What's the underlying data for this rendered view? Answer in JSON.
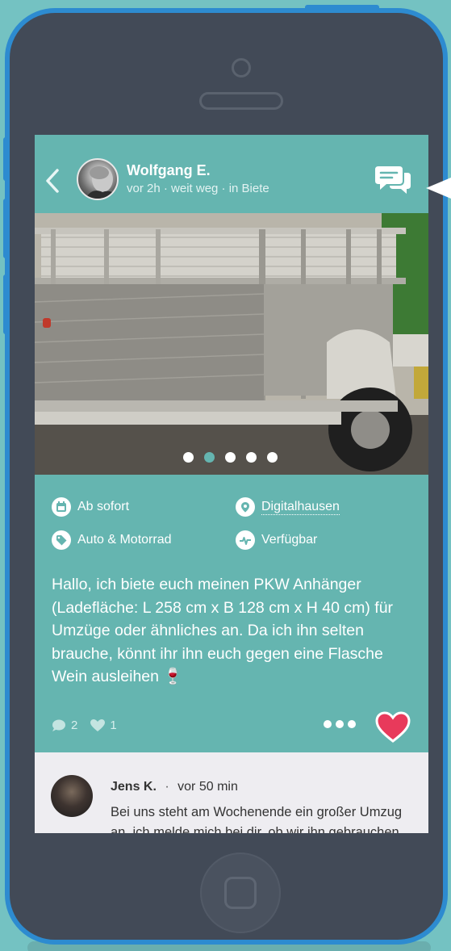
{
  "header": {
    "author": "Wolfgang E.",
    "meta": "vor 2h · weit weg · in Biete"
  },
  "carousel": {
    "count": 5,
    "active_index": 1
  },
  "tags": {
    "date": "Ab sofort",
    "location": "Digitalhausen",
    "category": "Auto & Motorrad",
    "status": "Verfügbar"
  },
  "post": {
    "text": "Hallo, ich biete euch meinen PKW Anhänger (Ladefläche: L 258 cm x B 128 cm x H 40 cm) für Umzüge oder ähnliches an. Da ich ihn selten brauche, könnt ihr ihn euch gegen eine Flasche Wein ausleihen 🍷"
  },
  "stats": {
    "comments": "2",
    "likes": "1"
  },
  "comment": {
    "author": "Jens K.",
    "separator": "·",
    "time": "vor 50 min",
    "text": "Bei uns steht am Wochenende ein großer Umzug an, ich melde mich bei dir, ob wir ihn gebrauchen können."
  },
  "colors": {
    "teal": "#65b5b0",
    "phone_blue": "#2d8bd0",
    "heart": "#e83a5b"
  }
}
